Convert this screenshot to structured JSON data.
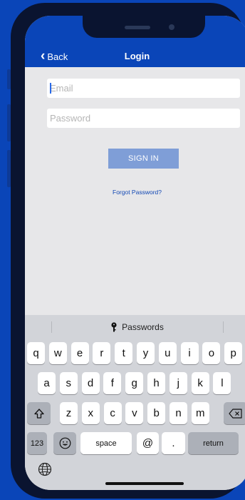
{
  "navbar": {
    "back_label": "Back",
    "title": "Login"
  },
  "form": {
    "email_placeholder": "Email",
    "password_placeholder": "Password",
    "signin_label": "SIGN IN",
    "forgot_label": "Forgot Password?"
  },
  "keyboard": {
    "passwords_label": "Passwords",
    "row1": [
      "q",
      "w",
      "e",
      "r",
      "t",
      "y",
      "u",
      "i",
      "o",
      "p"
    ],
    "row2": [
      "a",
      "s",
      "d",
      "f",
      "g",
      "h",
      "j",
      "k",
      "l"
    ],
    "row3": [
      "z",
      "x",
      "c",
      "v",
      "b",
      "n",
      "m"
    ],
    "numbers_label": "123",
    "space_label": "space",
    "at_label": "@",
    "dot_label": ".",
    "return_label": "return"
  },
  "colors": {
    "brand": "#0a45b8",
    "signin": "#7f9ed7",
    "link": "#1248b4"
  }
}
